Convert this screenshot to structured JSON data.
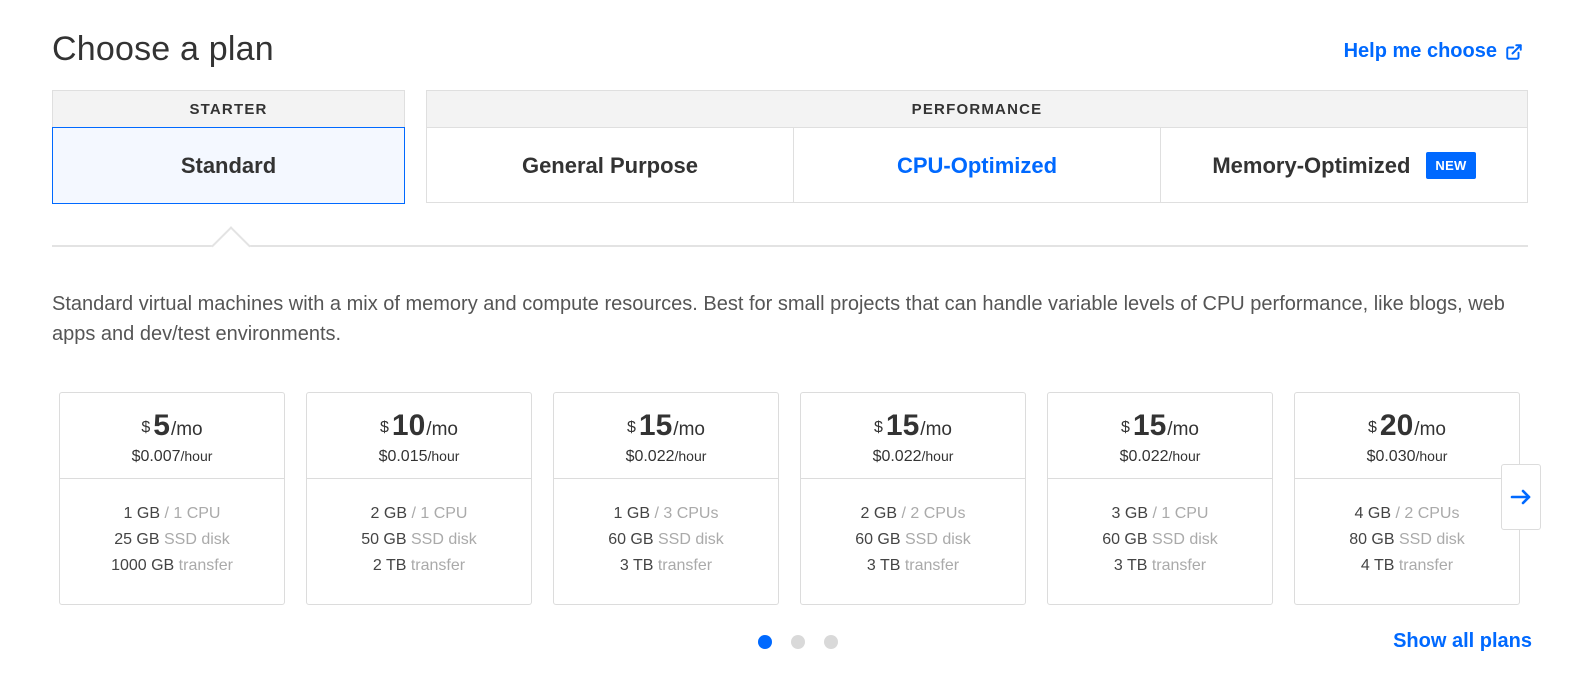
{
  "header": {
    "title": "Choose a plan",
    "help_label": "Help me choose"
  },
  "groups": {
    "starter": {
      "label": "STARTER",
      "tabs": [
        "Standard"
      ]
    },
    "performance": {
      "label": "PERFORMANCE",
      "tabs": [
        "General Purpose",
        "CPU-Optimized",
        "Memory-Optimized"
      ],
      "new_badge": "NEW"
    },
    "active_tab": "Standard"
  },
  "description": "Standard virtual machines with a mix of memory and compute resources. Best for small projects that can handle variable levels of CPU performance, like blogs, web apps and dev/test environments.",
  "plans": [
    {
      "currency": "$",
      "price": "5",
      "per": "/mo",
      "hourly": "$0.007",
      "hourly_unit": "/hour",
      "memory": "1 GB",
      "cpu": "/ 1 CPU",
      "disk": "25 GB",
      "disk_label": "SSD disk",
      "transfer": "1000 GB",
      "transfer_label": "transfer"
    },
    {
      "currency": "$",
      "price": "10",
      "per": "/mo",
      "hourly": "$0.015",
      "hourly_unit": "/hour",
      "memory": "2 GB",
      "cpu": "/ 1 CPU",
      "disk": "50 GB",
      "disk_label": "SSD disk",
      "transfer": "2 TB",
      "transfer_label": "transfer"
    },
    {
      "currency": "$",
      "price": "15",
      "per": "/mo",
      "hourly": "$0.022",
      "hourly_unit": "/hour",
      "memory": "1 GB",
      "cpu": "/ 3 CPUs",
      "disk": "60 GB",
      "disk_label": "SSD disk",
      "transfer": "3 TB",
      "transfer_label": "transfer"
    },
    {
      "currency": "$",
      "price": "15",
      "per": "/mo",
      "hourly": "$0.022",
      "hourly_unit": "/hour",
      "memory": "2 GB",
      "cpu": "/ 2 CPUs",
      "disk": "60 GB",
      "disk_label": "SSD disk",
      "transfer": "3 TB",
      "transfer_label": "transfer"
    },
    {
      "currency": "$",
      "price": "15",
      "per": "/mo",
      "hourly": "$0.022",
      "hourly_unit": "/hour",
      "memory": "3 GB",
      "cpu": "/ 1 CPU",
      "disk": "60 GB",
      "disk_label": "SSD disk",
      "transfer": "3 TB",
      "transfer_label": "transfer"
    },
    {
      "currency": "$",
      "price": "20",
      "per": "/mo",
      "hourly": "$0.030",
      "hourly_unit": "/hour",
      "memory": "4 GB",
      "cpu": "/ 2 CPUs",
      "disk": "80 GB",
      "disk_label": "SSD disk",
      "transfer": "4 TB",
      "transfer_label": "transfer"
    }
  ],
  "pagination": {
    "pages": 3,
    "current": 1
  },
  "icons": {
    "help": "external-link-icon",
    "next": "arrow-right-icon"
  },
  "colors": {
    "accent": "#0069ff"
  },
  "footer": {
    "show_all_label": "Show all plans"
  }
}
